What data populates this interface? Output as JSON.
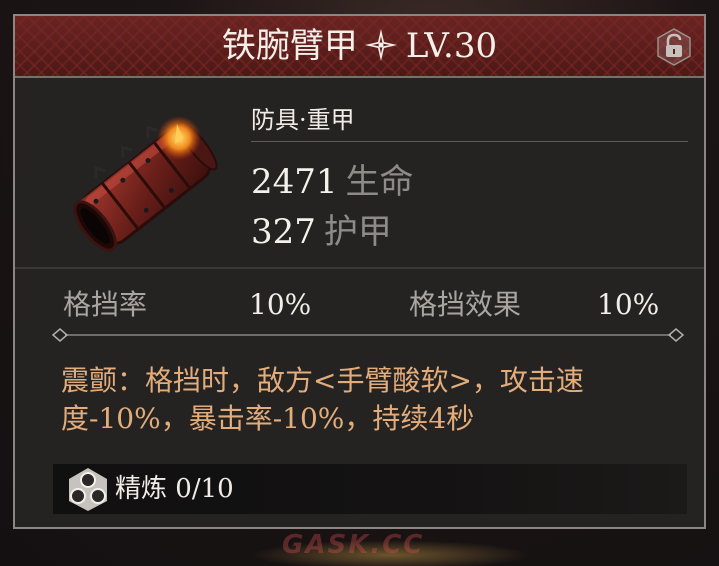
{
  "item": {
    "name": "铁腕臂甲",
    "level": "LV.30",
    "type": "防具·重甲"
  },
  "stats": [
    {
      "value": "2471",
      "name": "生命"
    },
    {
      "value": "327",
      "name": "护甲"
    }
  ],
  "block": {
    "rate_label": "格挡率",
    "rate_value": "10%",
    "effect_label": "格挡效果",
    "effect_value": "10%"
  },
  "effect_text": "震颤：格挡时，敌方<手臂酸软>，攻击速度-10%，暴击率-10%，持续4秒",
  "refine": {
    "label": "精炼",
    "value": "0/10"
  },
  "watermark": "GASK.CC",
  "colors": {
    "header_bg": "#5a1d1b",
    "panel_bg": "#252222",
    "effect_text": "#e3ad7b",
    "stat_name": "#8e8a87"
  },
  "icons": [
    "star-sparkle-icon",
    "lock-icon",
    "refine-orbs-icon",
    "arm-guard-item-icon"
  ]
}
